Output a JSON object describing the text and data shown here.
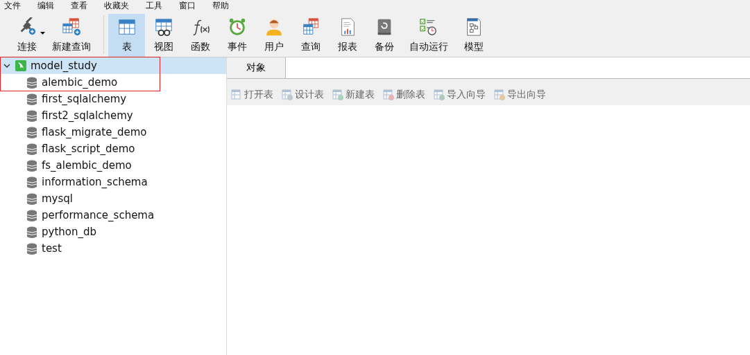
{
  "menu": [
    "文件",
    "编辑",
    "查看",
    "收藏夹",
    "工具",
    "窗口",
    "帮助"
  ],
  "toolbar": [
    {
      "label": "连接",
      "selected": false,
      "dropdown": true
    },
    {
      "label": "新建查询",
      "selected": false,
      "dropdown": false
    },
    {
      "label": "表",
      "selected": true,
      "dropdown": false
    },
    {
      "label": "视图",
      "selected": false,
      "dropdown": false
    },
    {
      "label": "函数",
      "selected": false,
      "dropdown": false
    },
    {
      "label": "事件",
      "selected": false,
      "dropdown": false
    },
    {
      "label": "用户",
      "selected": false,
      "dropdown": false
    },
    {
      "label": "查询",
      "selected": false,
      "dropdown": false
    },
    {
      "label": "报表",
      "selected": false,
      "dropdown": false
    },
    {
      "label": "备份",
      "selected": false,
      "dropdown": false
    },
    {
      "label": "自动运行",
      "selected": false,
      "dropdown": false
    },
    {
      "label": "模型",
      "selected": false,
      "dropdown": false
    }
  ],
  "tree": [
    {
      "label": "model_study",
      "expanded": true,
      "selected": true,
      "children": [
        {
          "label": "alembic_demo",
          "selected": false
        },
        {
          "label": "first_sqlalchemy",
          "selected": false
        },
        {
          "label": "first2_sqlalchemy",
          "selected": false
        },
        {
          "label": "flask_migrate_demo",
          "selected": false
        },
        {
          "label": "flask_script_demo",
          "selected": false
        },
        {
          "label": "fs_alembic_demo",
          "selected": false
        },
        {
          "label": "information_schema",
          "selected": false
        },
        {
          "label": "mysql",
          "selected": false
        },
        {
          "label": "performance_schema",
          "selected": false
        },
        {
          "label": "python_db",
          "selected": false
        },
        {
          "label": "test",
          "selected": false
        }
      ]
    }
  ],
  "tabs": [
    {
      "label": "对象",
      "selected": true
    }
  ],
  "object_actions": [
    {
      "label": "打开表",
      "disabled": true
    },
    {
      "label": "设计表",
      "disabled": true
    },
    {
      "label": "新建表",
      "disabled": true
    },
    {
      "label": "删除表",
      "disabled": true
    },
    {
      "label": "导入向导",
      "disabled": true
    },
    {
      "label": "导出向导",
      "disabled": true
    }
  ]
}
